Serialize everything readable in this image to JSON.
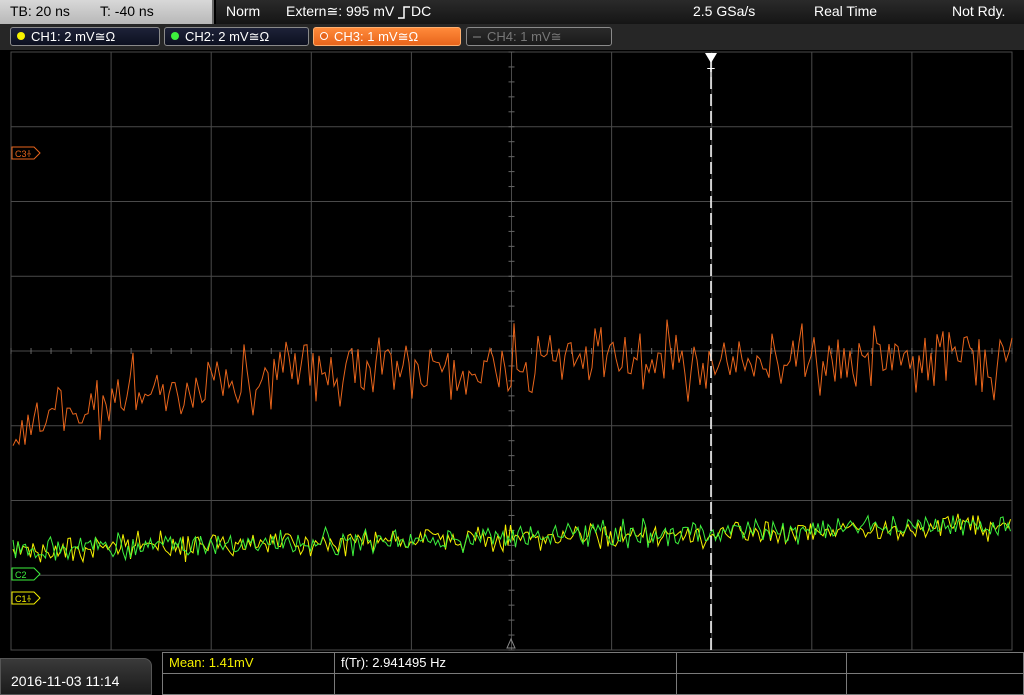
{
  "topbar": {
    "timebase": "TB: 20 ns",
    "trigger_offset": "T: -40 ns",
    "trigger_mode": "Norm",
    "trigger_source": "Extern≅: 995 mV",
    "trigger_coupling": "DC",
    "sample_rate": "2.5 GSa/s",
    "acq_mode": "Real Time",
    "acq_status": "Not Rdy."
  },
  "channels": [
    {
      "label": "CH1: 2 mV",
      "coupling": "≅Ω",
      "color": "#f5f000"
    },
    {
      "label": "CH2: 2 mV",
      "coupling": "≅Ω",
      "color": "#3df03d"
    },
    {
      "label": "CH3: 1 mV",
      "coupling": "≅Ω",
      "color": "#e8651c"
    },
    {
      "label": "CH4: 1 mV",
      "coupling": "≅",
      "color": "#777777"
    }
  ],
  "markers": {
    "c3": "C3",
    "c1": "C1",
    "c2": "C2",
    "trigger": "T"
  },
  "measurements": {
    "mean": "Mean: 1.41mV",
    "freq": "f(Tr): 2.941495 Hz"
  },
  "datetime": "2016-11-03 11:14",
  "colors": {
    "grid": "#4a4a4a",
    "ch1": "#f5f000",
    "ch2": "#3df03d",
    "ch3": "#e8651c",
    "measure_text": "#f5f000"
  }
}
